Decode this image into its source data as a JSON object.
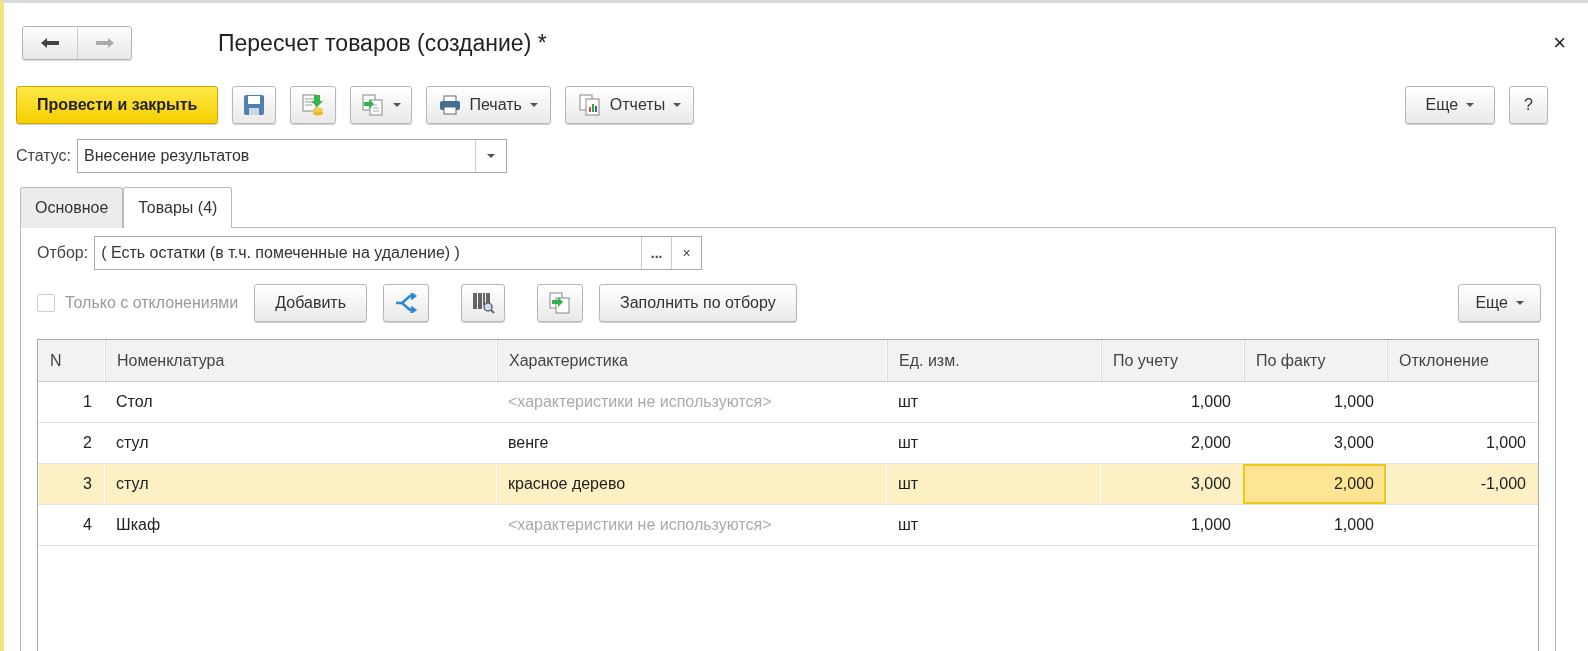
{
  "window": {
    "title": "Пересчет товаров (создание) *",
    "close": "×"
  },
  "toolbar": {
    "primary": "Провести и закрыть",
    "print": "Печать",
    "reports": "Отчеты",
    "more": "Еще",
    "help": "?"
  },
  "status": {
    "label": "Статус:",
    "value": "Внесение результатов"
  },
  "tabs": [
    {
      "label": "Основное",
      "selected": false
    },
    {
      "label": "Товары (4)",
      "selected": true
    }
  ],
  "filter": {
    "label": "Отбор:",
    "value": "( Есть остатки (в т.ч. помеченные на удаление) )",
    "choose": "...",
    "clear": "×"
  },
  "table_toolbar": {
    "only_deviations": {
      "label": "Только с отклонениями",
      "checked": false,
      "disabled": true
    },
    "add": "Добавить",
    "fill": "Заполнить по отбору",
    "more": "Еще"
  },
  "table": {
    "columns": [
      "N",
      "Номенклатура",
      "Характеристика",
      "Ед. изм.",
      "По учету",
      "По факту",
      "Отклонение"
    ],
    "rows": [
      {
        "n": "1",
        "item": "Стол",
        "characteristic": "<характеристики не используются>",
        "characteristic_used": false,
        "unit": "шт",
        "book": "1,000",
        "fact": "1,000",
        "selected": false,
        "fact_focused": false
      },
      {
        "n": "2",
        "item": "стул",
        "characteristic": "венге",
        "characteristic_used": true,
        "unit": "шт",
        "book": "2,000",
        "fact": "3,000",
        "deviation": "1,000",
        "selected": false,
        "fact_focused": false
      },
      {
        "n": "3",
        "item": "стул",
        "characteristic": "красное дерево",
        "characteristic_used": true,
        "unit": "шт",
        "book": "3,000",
        "fact": "2,000",
        "deviation": "-1,000",
        "selected": true,
        "fact_focused": true
      },
      {
        "n": "4",
        "item": "Шкаф",
        "characteristic": "<характеристики не используются>",
        "characteristic_used": false,
        "unit": "шт",
        "book": "1,000",
        "fact": "1,000",
        "selected": false,
        "fact_focused": false
      }
    ]
  }
}
